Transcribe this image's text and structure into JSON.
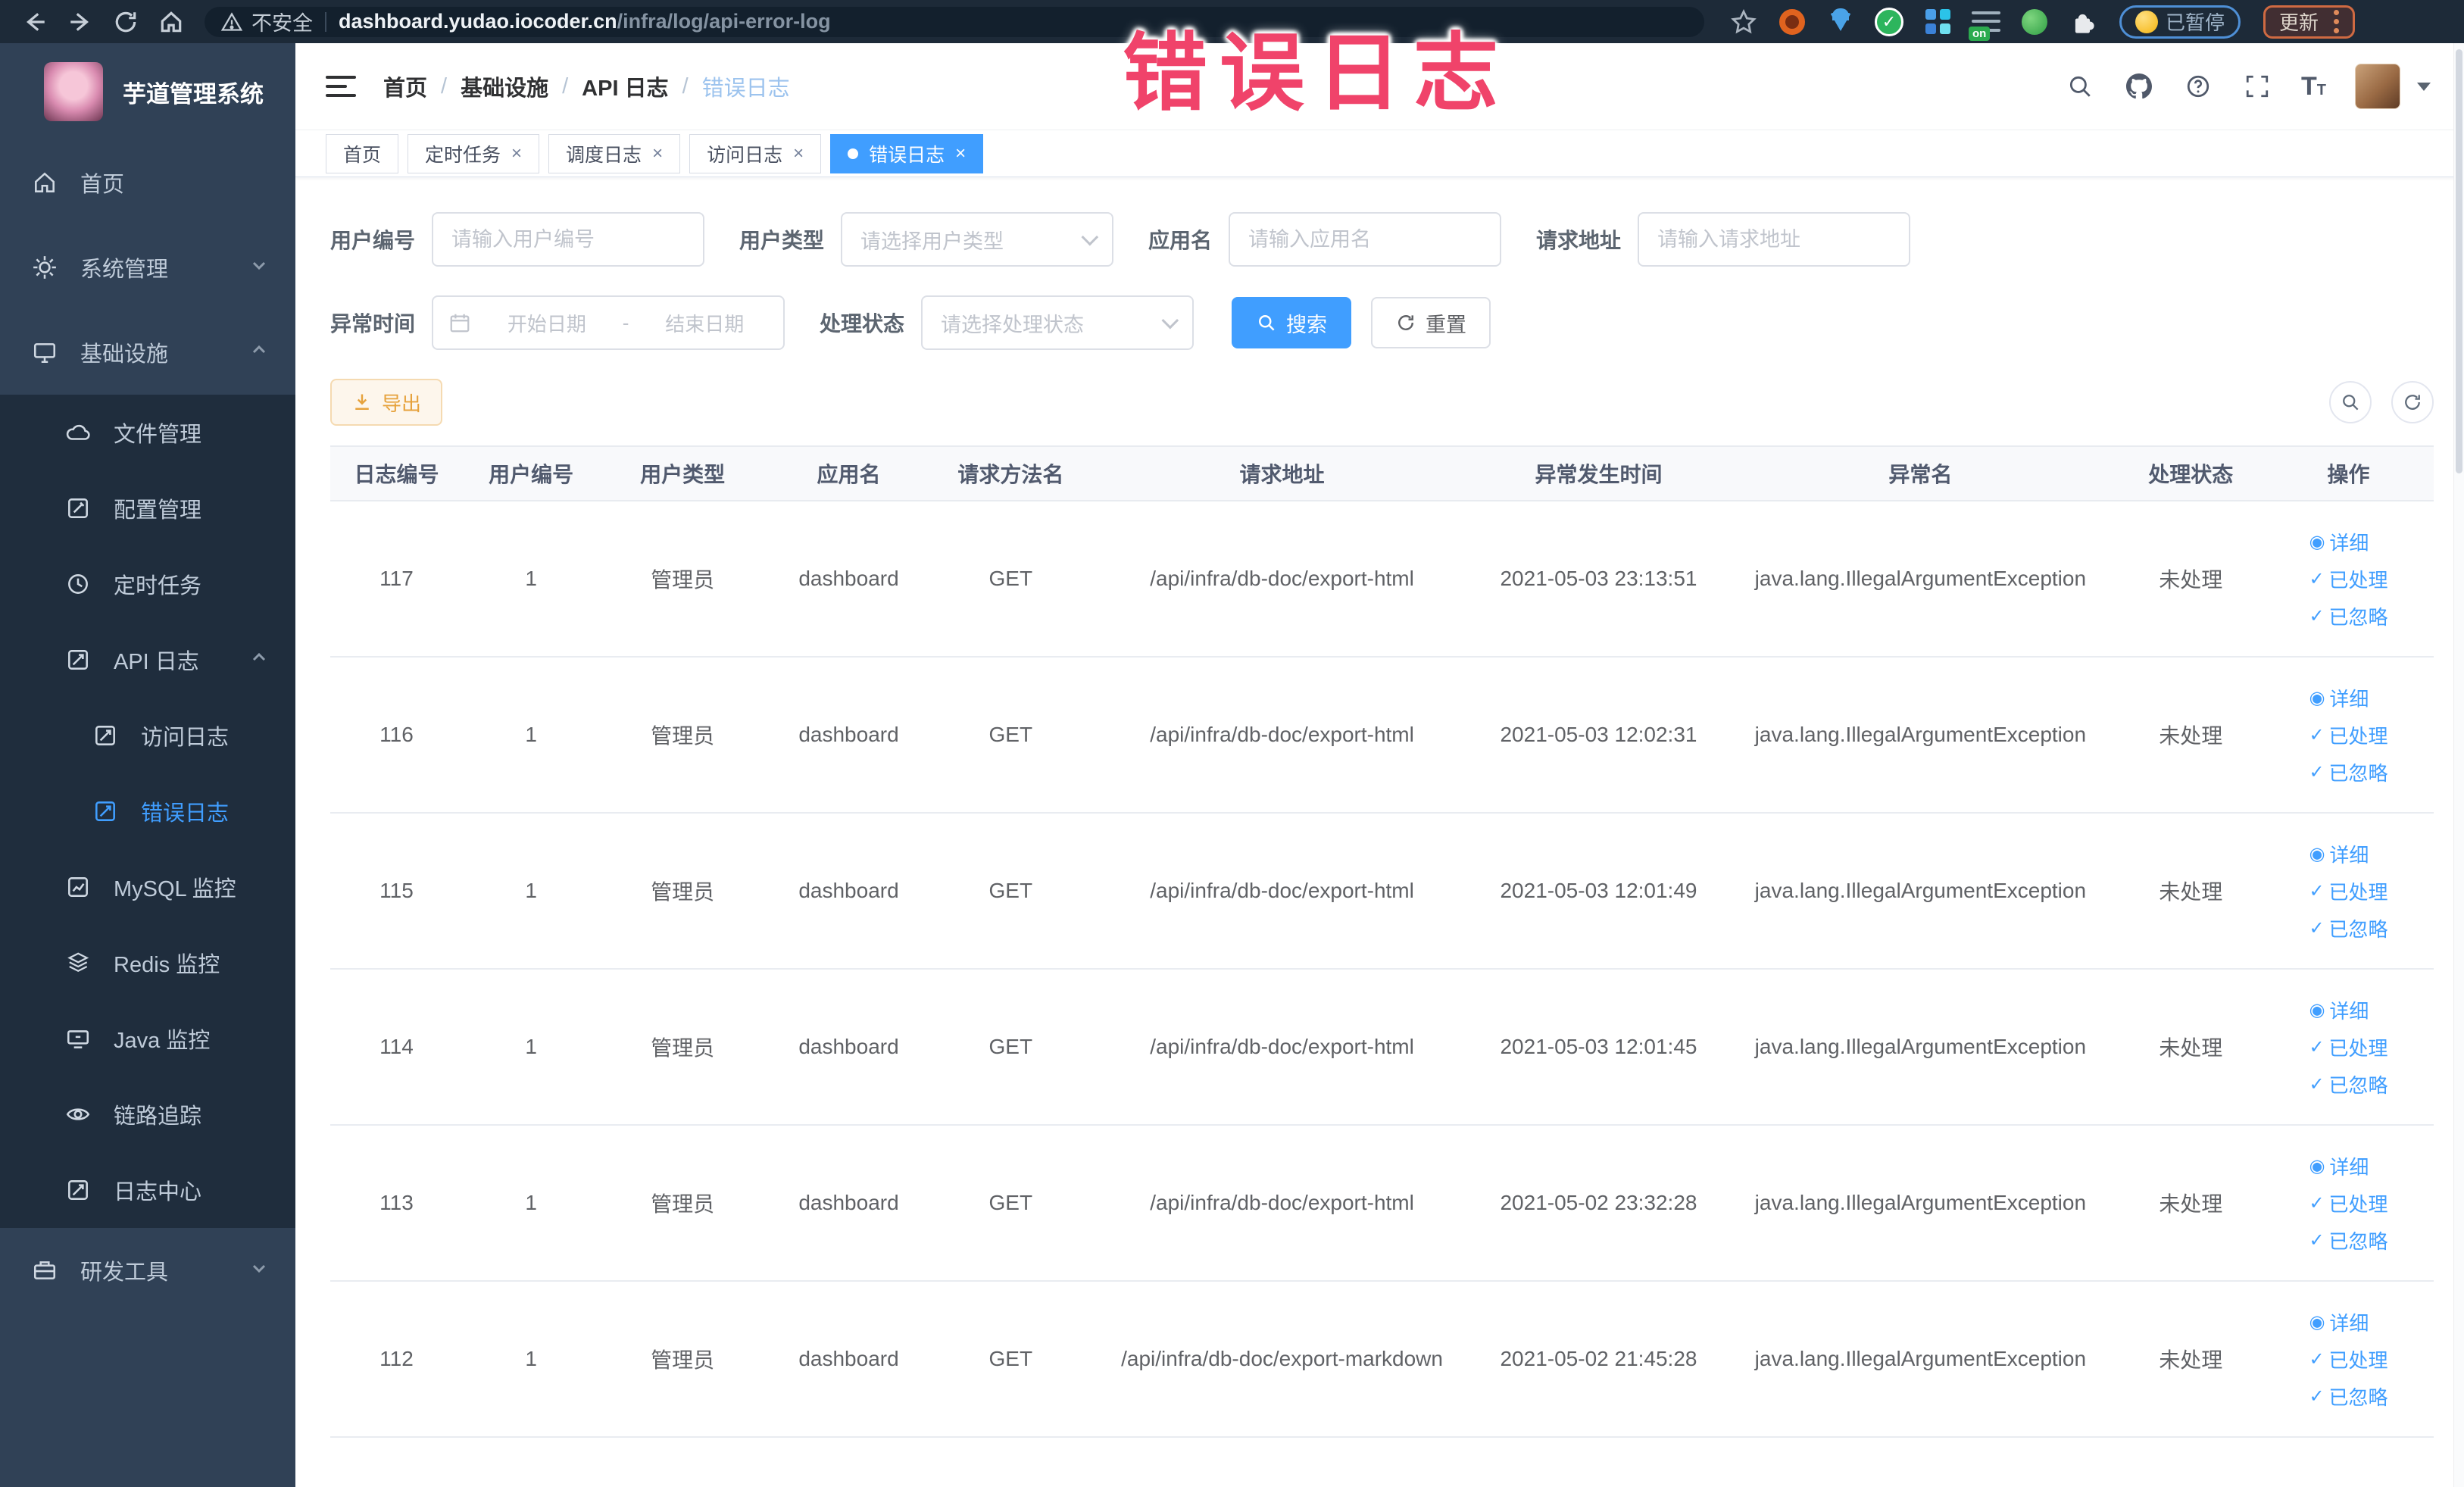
{
  "annotation": {
    "text": "错误日志"
  },
  "colors": {
    "primary": "#409eff",
    "warning": "#e6a23c",
    "annotation_pink": "#f0436a",
    "sidebar_bg": "#304156",
    "submenu_bg": "#1f2d3d"
  },
  "browser": {
    "security_label": "不安全",
    "url_host": "dashboard.yudao.iocoder.cn",
    "url_path": "/infra/log/api-error-log",
    "paused_badge": "已暂停",
    "update_badge": "更新",
    "on_badge": "on"
  },
  "sidebar": {
    "logo_title": "芋道管理系统",
    "items": {
      "home": "首页",
      "system": "系统管理",
      "infra": "基础设施",
      "dev": "研发工具"
    },
    "infra_children": {
      "file": "文件管理",
      "config": "配置管理",
      "job": "定时任务",
      "api_log": "API 日志",
      "access_log": "访问日志",
      "error_log": "错误日志",
      "mysql": "MySQL 监控",
      "redis": "Redis 监控",
      "java": "Java 监控",
      "trace": "链路追踪",
      "log_center": "日志中心"
    }
  },
  "breadcrumb": {
    "items": [
      "首页",
      "基础设施",
      "API 日志",
      "错误日志"
    ]
  },
  "tabs": {
    "items": [
      {
        "label": "首页"
      },
      {
        "label": "定时任务"
      },
      {
        "label": "调度日志"
      },
      {
        "label": "访问日志"
      },
      {
        "label": "错误日志"
      }
    ]
  },
  "filters": {
    "user_id": {
      "label": "用户编号",
      "placeholder": "请输入用户编号"
    },
    "user_type": {
      "label": "用户类型",
      "placeholder": "请选择用户类型"
    },
    "app_name": {
      "label": "应用名",
      "placeholder": "请输入应用名"
    },
    "request_url": {
      "label": "请求地址",
      "placeholder": "请输入请求地址"
    },
    "time": {
      "label": "异常时间",
      "start_placeholder": "开始日期",
      "separator": "-",
      "end_placeholder": "结束日期"
    },
    "status": {
      "label": "处理状态",
      "placeholder": "请选择处理状态"
    },
    "search_label": "搜索",
    "reset_label": "重置"
  },
  "toolbar": {
    "export_label": "导出"
  },
  "table": {
    "columns": [
      "日志编号",
      "用户编号",
      "用户类型",
      "应用名",
      "请求方法名",
      "请求地址",
      "异常发生时间",
      "异常名",
      "处理状态",
      "操作"
    ],
    "row_actions": [
      {
        "name": "detail",
        "icon": "eye",
        "glyph": "◉",
        "label": "详细"
      },
      {
        "name": "processed",
        "icon": "check",
        "glyph": "✓",
        "label": "已处理"
      },
      {
        "name": "ignored",
        "icon": "check",
        "glyph": "✓",
        "label": "已忽略"
      }
    ],
    "rows": [
      [
        "117",
        "1",
        "管理员",
        "dashboard",
        "GET",
        "/api/infra/db-doc/export-html",
        "2021-05-03 23:13:51",
        "java.lang.IllegalArgumentException",
        "未处理"
      ],
      [
        "116",
        "1",
        "管理员",
        "dashboard",
        "GET",
        "/api/infra/db-doc/export-html",
        "2021-05-03 12:02:31",
        "java.lang.IllegalArgumentException",
        "未处理"
      ],
      [
        "115",
        "1",
        "管理员",
        "dashboard",
        "GET",
        "/api/infra/db-doc/export-html",
        "2021-05-03 12:01:49",
        "java.lang.IllegalArgumentException",
        "未处理"
      ],
      [
        "114",
        "1",
        "管理员",
        "dashboard",
        "GET",
        "/api/infra/db-doc/export-html",
        "2021-05-03 12:01:45",
        "java.lang.IllegalArgumentException",
        "未处理"
      ],
      [
        "113",
        "1",
        "管理员",
        "dashboard",
        "GET",
        "/api/infra/db-doc/export-html",
        "2021-05-02 23:32:28",
        "java.lang.IllegalArgumentException",
        "未处理"
      ],
      [
        "112",
        "1",
        "管理员",
        "dashboard",
        "GET",
        "/api/infra/db-doc/export-markdown",
        "2021-05-02 21:45:28",
        "java.lang.IllegalArgumentException",
        "未处理"
      ]
    ]
  }
}
